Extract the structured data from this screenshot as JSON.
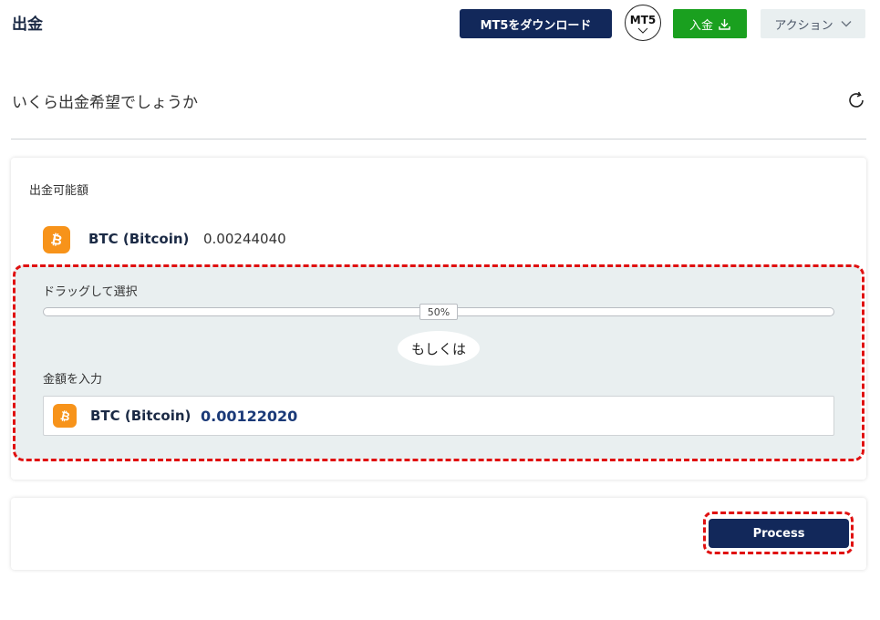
{
  "header": {
    "title": "出金",
    "download_label": "MT5をダウンロード",
    "platform_badge": "MT5",
    "deposit_label": "入金",
    "action_label": "アクション"
  },
  "question": "いくら出金希望でしょうか",
  "available": {
    "label": "出金可能額",
    "currency": "BTC (Bitcoin)",
    "amount": "0.00244040"
  },
  "selector": {
    "drag_label": "ドラッグして選択",
    "slider_percent": 50,
    "slider_text": "50%",
    "or_text": "もしくは",
    "amount_label": "金額を入力",
    "currency": "BTC (Bitcoin)",
    "value": "0.00122020"
  },
  "process_label": "Process",
  "colors": {
    "navy": "#12285a",
    "green": "#1aa01f",
    "bitcoin_orange": "#f7931a",
    "highlight_red": "#e01010",
    "panel_gray": "#e9eff0"
  },
  "icons": {
    "download": "download-icon",
    "chevron": "chevron-down-icon",
    "refresh": "refresh-icon",
    "bitcoin": "bitcoin-icon"
  }
}
